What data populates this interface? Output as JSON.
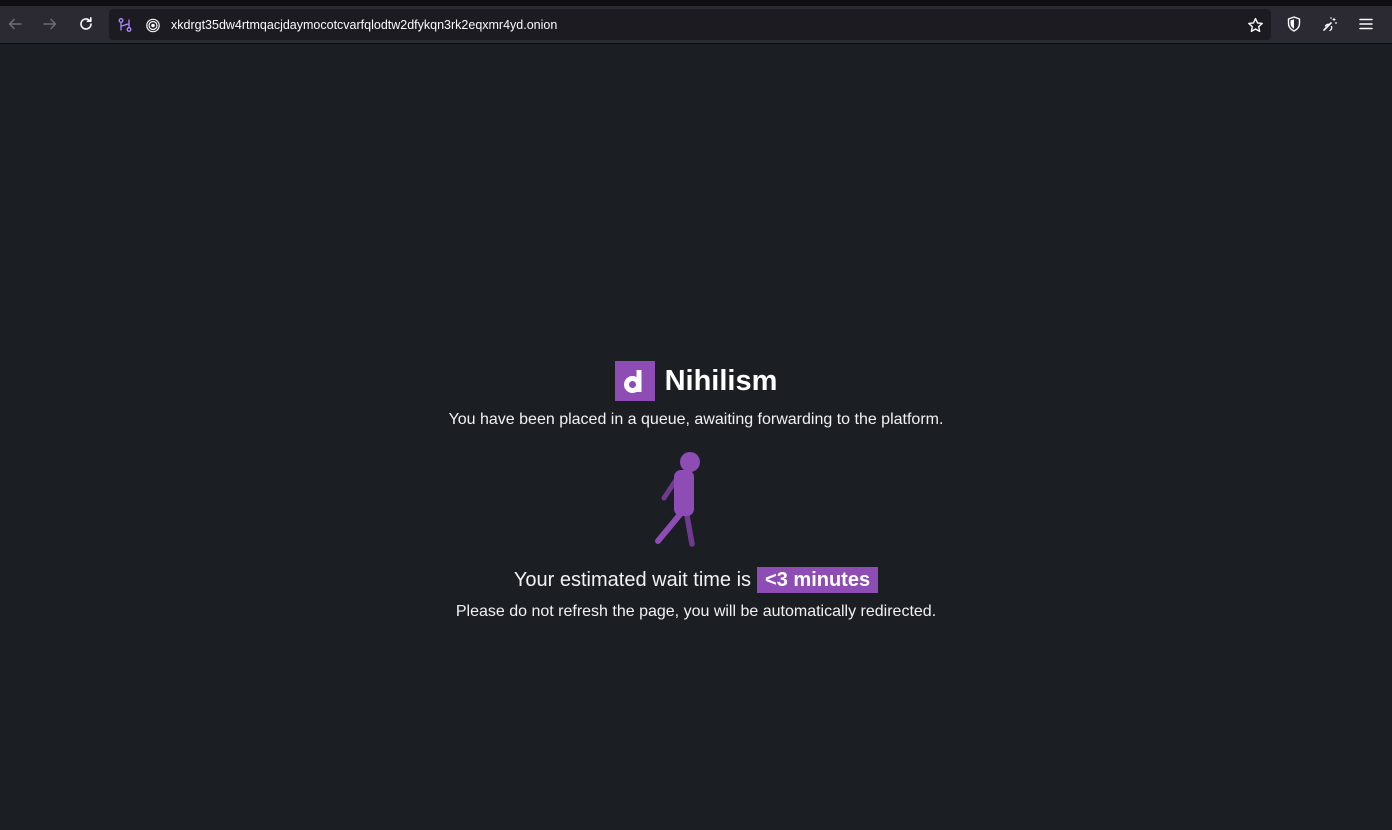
{
  "browser": {
    "url": "xkdrgt35dw4rtmqacjdaymocotcvarfqlodtw2dfykqn3rk2eqxmr4yd.onion",
    "icons": [
      "back-arrow-icon",
      "forward-arrow-icon",
      "reload-icon",
      "tor-circuit-icon",
      "onion-icon",
      "bookmark-star-icon",
      "shield-icon",
      "new-identity-icon",
      "menu-icon"
    ]
  },
  "page": {
    "logo_letter": "d",
    "brand_name": "Nihilism",
    "queue_message": "You have been placed in a queue, awaiting forwarding to the platform.",
    "wait_prefix": "Your estimated wait time is",
    "wait_time": "<3 minutes",
    "redirect_message": "Please do not refresh the page, you will be automatically redirected.",
    "accent_color": "#8e4cb5",
    "background_color": "#1b1e23"
  }
}
